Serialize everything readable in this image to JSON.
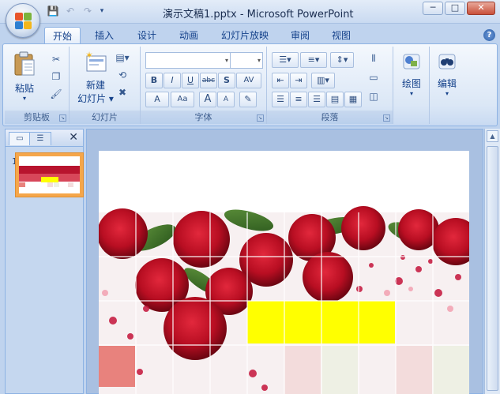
{
  "window": {
    "title": "演示文稿1.pptx - Microsoft PowerPoint",
    "minimize": "─",
    "maximize": "□",
    "close": "✕"
  },
  "quick_access": {
    "save_icon": "💾",
    "undo_icon": "↶",
    "redo_icon": "↷",
    "dropdown": "▾"
  },
  "tabs": [
    "开始",
    "插入",
    "设计",
    "动画",
    "幻灯片放映",
    "审阅",
    "视图"
  ],
  "active_tab": "开始",
  "help": "?",
  "groups": {
    "clipboard": {
      "label": "剪贴板",
      "paste": "粘贴"
    },
    "slides": {
      "label": "幻灯片",
      "new_slide_line1": "新建",
      "new_slide_line2": "幻灯片"
    },
    "font": {
      "label": "字体",
      "bold": "B",
      "italic": "I",
      "underline": "U",
      "strike": "abc",
      "shadow": "S",
      "spacing": "AV",
      "font_color": "A",
      "change_case": "Aa",
      "grow": "A",
      "shrink": "A",
      "clear": "✎"
    },
    "paragraph": {
      "label": "段落"
    },
    "drawing": {
      "label": "绘图"
    },
    "editing": {
      "label": "编辑"
    }
  },
  "slides_pane": {
    "slide_number": "1",
    "close": "✕"
  },
  "colors": {
    "accent_yellow": "#ffff00",
    "rose_red": "#c8102e",
    "pink_cell": "#e8827d",
    "light_pink": "#f3dcdc",
    "light_green": "#eef0e4",
    "thumb_border": "#f5a64a"
  }
}
